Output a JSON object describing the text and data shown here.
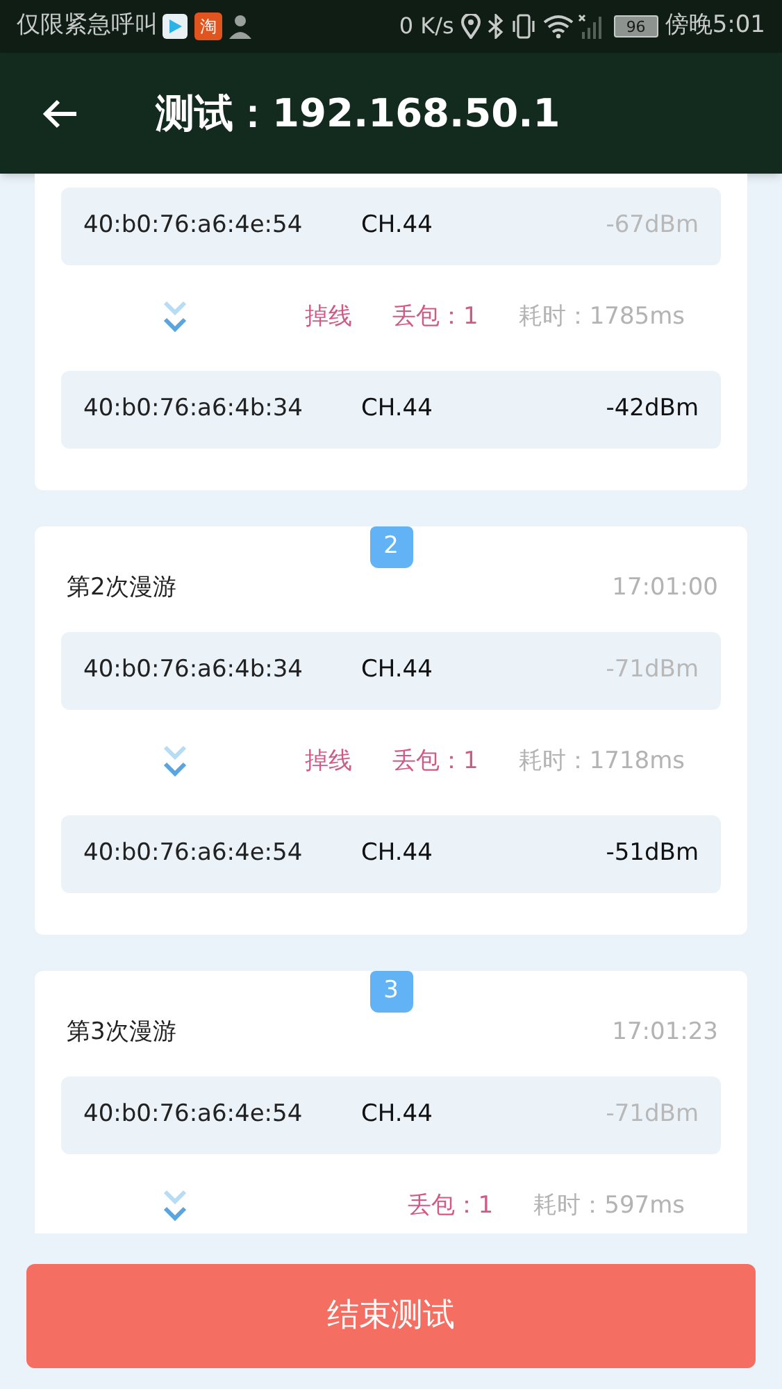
{
  "status_bar": {
    "carrier": "仅限紧急呼叫",
    "app_badge": "淘",
    "speed": "0 K/s",
    "battery": "96",
    "time": "傍晚5:01"
  },
  "header": {
    "title": "测试：192.168.50.1"
  },
  "roams": [
    {
      "aps": [
        {
          "mac": "40:b0:76:a6:4e:54",
          "channel": "CH.44",
          "signal": "-67dBm",
          "muted": true
        },
        {
          "mac": "40:b0:76:a6:4b:34",
          "channel": "CH.44",
          "signal": "-42dBm",
          "muted": false
        }
      ],
      "transition": {
        "dropped": "掉线",
        "loss": "丢包：1",
        "duration": "耗时：1785ms"
      }
    },
    {
      "index": "2",
      "title": "第2次漫游",
      "time": "17:01:00",
      "aps": [
        {
          "mac": "40:b0:76:a6:4b:34",
          "channel": "CH.44",
          "signal": "-71dBm",
          "muted": true
        },
        {
          "mac": "40:b0:76:a6:4e:54",
          "channel": "CH.44",
          "signal": "-51dBm",
          "muted": false
        }
      ],
      "transition": {
        "dropped": "掉线",
        "loss": "丢包：1",
        "duration": "耗时：1718ms"
      }
    },
    {
      "index": "3",
      "title": "第3次漫游",
      "time": "17:01:23",
      "aps": [
        {
          "mac": "40:b0:76:a6:4e:54",
          "channel": "CH.44",
          "signal": "-71dBm",
          "muted": true
        }
      ],
      "transition": {
        "loss": "丢包：1",
        "duration": "耗时：597ms"
      }
    }
  ],
  "end_button": {
    "label": "结束测试"
  }
}
